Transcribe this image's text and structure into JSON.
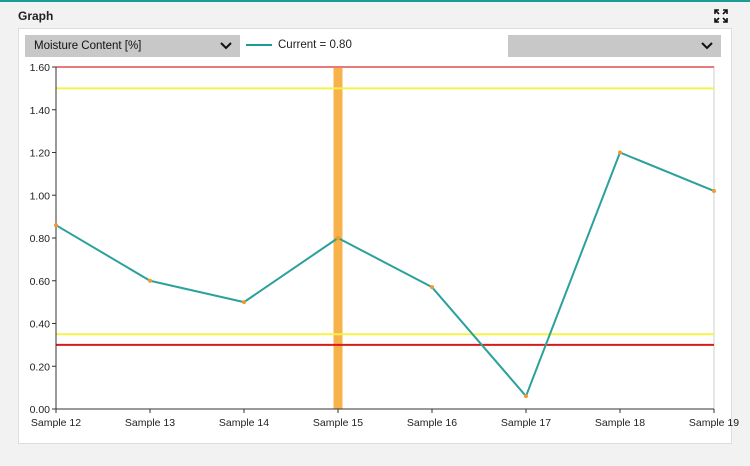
{
  "panel": {
    "title": "Graph"
  },
  "controls": {
    "measure_select": {
      "value": "Moisture Content [%]"
    },
    "secondary_select": {
      "value": ""
    }
  },
  "legend": {
    "current_label": "Current = 0.80"
  },
  "colors": {
    "accent": "#1a9c98",
    "series": "#2aa19b",
    "upper_limit": "#e87a7a",
    "warning": "#f5f24a",
    "lower_limit": "#d81a1a",
    "highlight": "#f7b24a",
    "marker": "#f29a2e"
  },
  "icons": {
    "expand": "expand-icon",
    "dropdown": "chevron-down-icon"
  },
  "chart_data": {
    "type": "line",
    "categories": [
      "Sample 12",
      "Sample 13",
      "Sample 14",
      "Sample 15",
      "Sample 16",
      "Sample 17",
      "Sample 18",
      "Sample 19"
    ],
    "series": [
      {
        "name": "Current",
        "values": [
          0.86,
          0.6,
          0.5,
          0.8,
          0.57,
          0.06,
          1.2,
          1.02
        ]
      }
    ],
    "ylim": [
      0,
      1.6
    ],
    "yticks": [
      "0.00",
      "0.20",
      "0.40",
      "0.60",
      "0.80",
      "1.00",
      "1.20",
      "1.40",
      "1.60"
    ],
    "reference_lines": [
      {
        "kind": "upper-limit",
        "value": 1.6
      },
      {
        "kind": "upper-warning",
        "value": 1.5
      },
      {
        "kind": "lower-warning",
        "value": 0.35
      },
      {
        "kind": "lower-limit",
        "value": 0.3
      }
    ],
    "highlight_category": "Sample 15",
    "grid": false
  }
}
